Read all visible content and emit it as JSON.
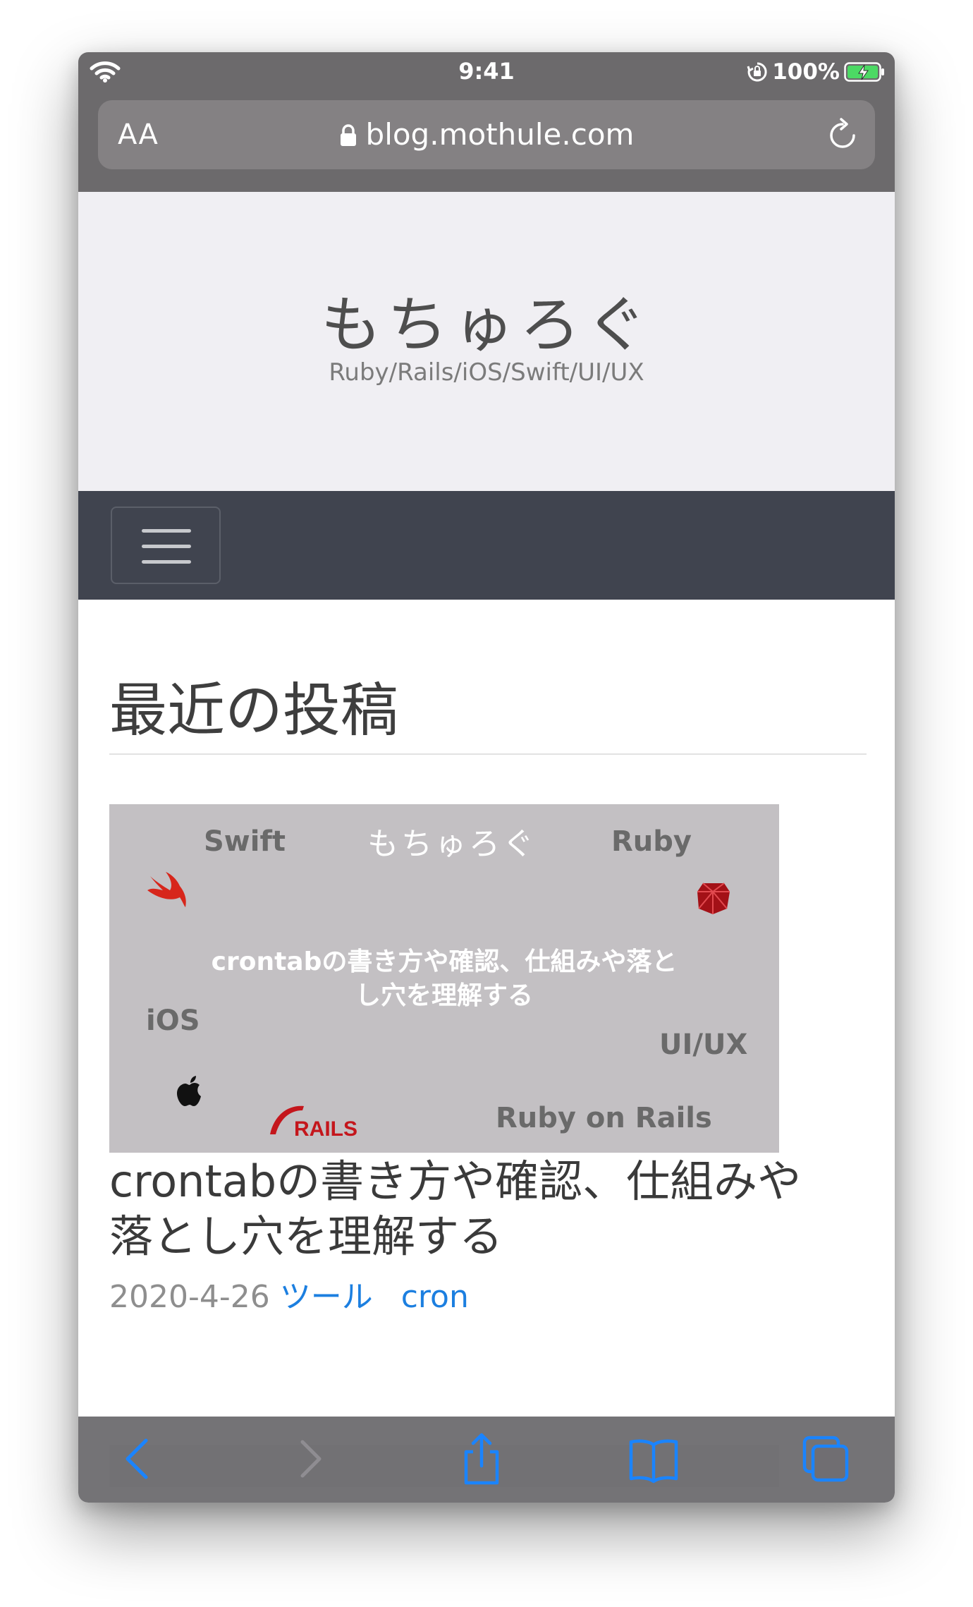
{
  "status_bar": {
    "time": "9:41",
    "battery_percent": "100%",
    "icons": [
      "wifi-icon",
      "orientation-lock-icon",
      "battery-charging-icon"
    ]
  },
  "url_bar": {
    "text_size_label": "AA",
    "domain": "blog.mothule.com",
    "icons": [
      "padlock-icon",
      "reload-icon"
    ]
  },
  "site": {
    "title": "もちゅろぐ",
    "subtitle": "Ruby/Rails/iOS/Swift/UI/UX"
  },
  "navbar": {
    "icons": [
      "hamburger-menu-icon"
    ]
  },
  "main": {
    "section_title": "最近の投稿",
    "posts": [
      {
        "thumbnail": {
          "brand": "もちゅろぐ",
          "labels": {
            "swift": "Swift",
            "ruby": "Ruby",
            "ios": "iOS",
            "uiux": "UI/UX",
            "rails_logo": "RAILS",
            "ruby_on_rails": "Ruby on Rails"
          },
          "headline_line1": "crontabの書き方や確認、仕組みや落と",
          "headline_line2": "し穴を理解する"
        },
        "title_line1": "crontabの書き方や確認、仕組みや",
        "title_line2": "落とし穴を理解する",
        "date": "2020-4-26",
        "category": "ツール",
        "tag": "cron"
      }
    ]
  },
  "toolbar": {
    "icons": [
      "back-icon",
      "forward-icon",
      "share-icon",
      "bookmarks-icon",
      "tabs-icon"
    ]
  },
  "colors": {
    "safari_chrome": "#6c6a6c",
    "url_field": "#848183",
    "header_bg": "#f0eff3",
    "navbar_bg": "#40444f",
    "link": "#1c7fe0",
    "thumbnail_bg": "#c3c0c3",
    "ruby_red": "#c4161c"
  }
}
